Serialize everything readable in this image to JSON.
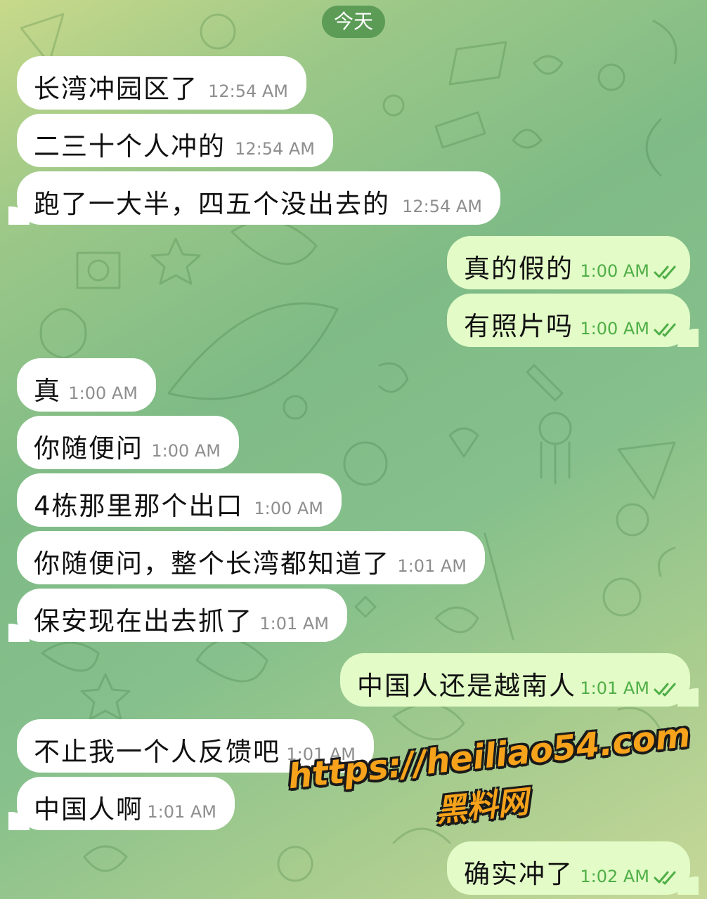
{
  "date_label": "今天",
  "messages": [
    {
      "dir": "in",
      "text": "长湾冲园区了",
      "time": "12:54 AM"
    },
    {
      "dir": "in",
      "text": "二三十个人冲的",
      "time": "12:54 AM"
    },
    {
      "dir": "in",
      "text": "跑了一大半，四五个没出去的",
      "time": "12:54 AM"
    },
    {
      "dir": "out",
      "text": "真的假的",
      "time": "1:00 AM",
      "status": "read"
    },
    {
      "dir": "out",
      "text": "有照片吗",
      "time": "1:00 AM",
      "status": "read"
    },
    {
      "dir": "in",
      "text": "真",
      "time": "1:00 AM"
    },
    {
      "dir": "in",
      "text": "你随便问",
      "time": "1:00 AM"
    },
    {
      "dir": "in",
      "text": "4栋那里那个出口",
      "time": "1:00 AM"
    },
    {
      "dir": "in",
      "text": "你随便问，整个长湾都知道了",
      "time": "1:01 AM"
    },
    {
      "dir": "in",
      "text": "保安现在出去抓了",
      "time": "1:01 AM"
    },
    {
      "dir": "out",
      "text": "中国人还是越南人",
      "time": "1:01 AM",
      "status": "read"
    },
    {
      "dir": "in",
      "text": "不止我一个人反馈吧",
      "time": "1:01 AM"
    },
    {
      "dir": "in",
      "text": "中国人啊",
      "time": "1:01 AM"
    },
    {
      "dir": "out",
      "text": "确实冲了",
      "time": "1:02 AM",
      "status": "read"
    }
  ],
  "watermark": {
    "url": "https://heiliao54.com",
    "name": "黑料网"
  },
  "colors": {
    "incoming_bubble": "#ffffff",
    "outgoing_bubble": "#e2fbc7",
    "outgoing_time": "#4fae46",
    "read_check": "#4fae46",
    "date_pill": "#468c46",
    "watermark": "#f6a21a"
  },
  "icons": {
    "read_status": "double-check-icon"
  }
}
